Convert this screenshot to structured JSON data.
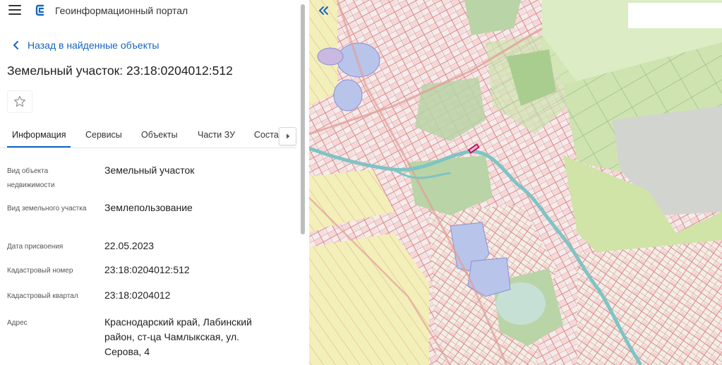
{
  "app": {
    "title": "Геоинформационный портал"
  },
  "nav": {
    "back_label": "Назад в найденные объекты"
  },
  "object": {
    "title": "Земельный участок: 23:18:0204012:512"
  },
  "tabs": [
    {
      "label": "Информация",
      "active": true
    },
    {
      "label": "Сервисы"
    },
    {
      "label": "Объекты"
    },
    {
      "label": "Части ЗУ"
    },
    {
      "label": "Соста"
    }
  ],
  "properties": [
    {
      "label": "Вид объекта недвижимости",
      "value": "Земельный участок"
    },
    {
      "label": "Вид земельного участка",
      "value": "Землепользование"
    },
    {
      "label": "Дата присвоения",
      "value": "22.05.2023"
    },
    {
      "label": "Кадастровый номер",
      "value": "23:18:0204012:512"
    },
    {
      "label": "Кадастровый квартал",
      "value": "23:18:0204012"
    },
    {
      "label": "Адрес",
      "value": "Краснодарский край, Лабинский район, ст-ца Чамлыкская, ул. Серова, 4"
    }
  ],
  "colors": {
    "accent": "#1565c0",
    "map_background": "#eef2e4",
    "parcel_border": "#d98a8a",
    "water": "#b8c4ea",
    "river": "#7fc4c4",
    "forest": "#b9d4a6",
    "field": "#f3f0b8",
    "selected_parcel": "#c2185b"
  },
  "icons": {
    "menu": "hamburger-menu-icon",
    "logo": "portal-logo-icon",
    "back": "chevron-left-icon",
    "favorite": "star-outline-icon",
    "tab_scroll": "chevron-right-icon",
    "collapse": "double-chevron-left-icon"
  }
}
